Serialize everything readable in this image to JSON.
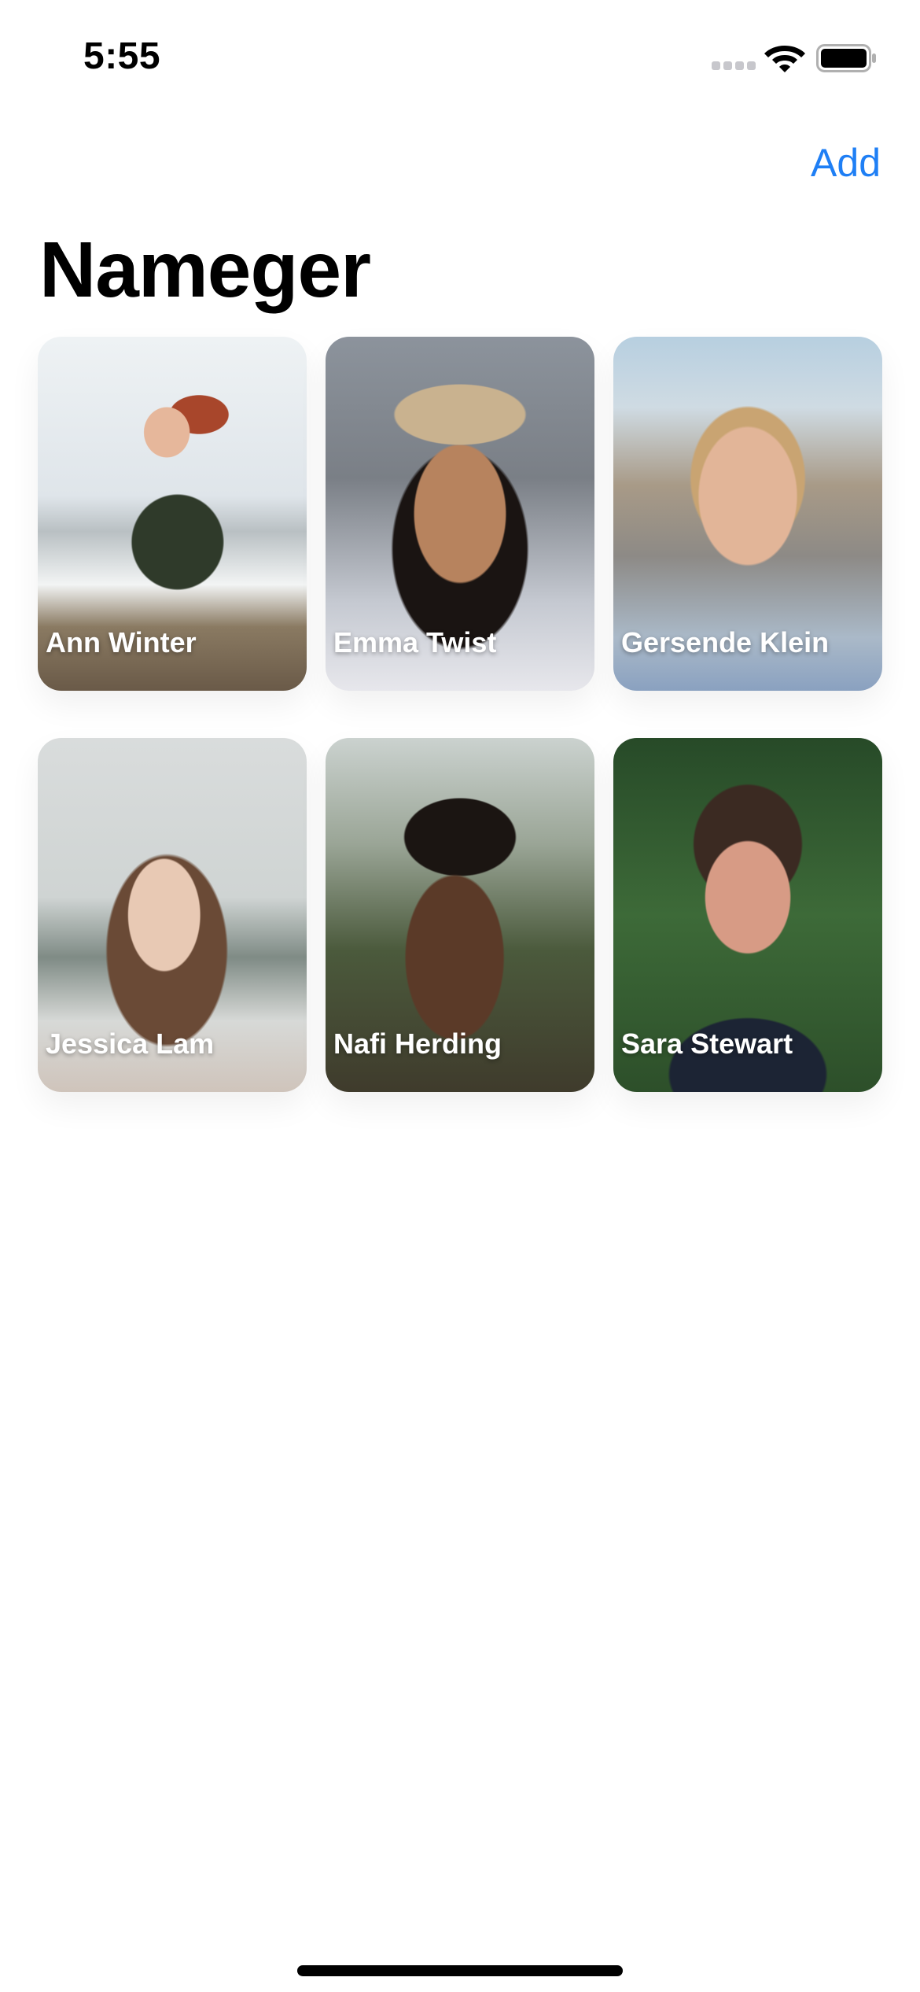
{
  "status_bar": {
    "time": "5:55"
  },
  "nav": {
    "add_label": "Add",
    "title": "Nameger"
  },
  "people": [
    {
      "name": "Ann Winter"
    },
    {
      "name": "Emma Twist"
    },
    {
      "name": "Gersende Klein"
    },
    {
      "name": "Jessica Lam"
    },
    {
      "name": "Nafi Herding"
    },
    {
      "name": "Sara Stewart"
    }
  ],
  "colors": {
    "accent": "#1f7ff5",
    "background": "#ffffff",
    "title": "#000000",
    "card_label": "#ffffff"
  },
  "icons": [
    "signal-icon",
    "wifi-icon",
    "battery-icon"
  ]
}
